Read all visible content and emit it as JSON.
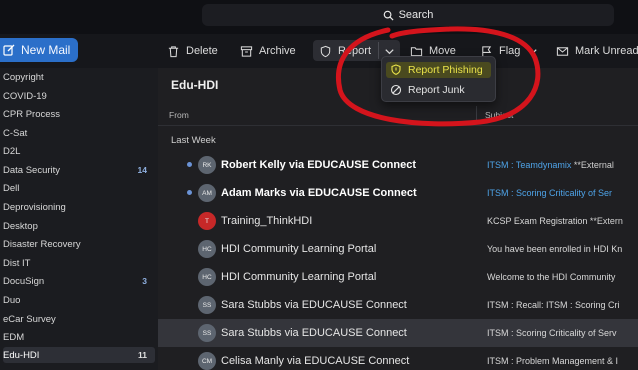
{
  "search": {
    "label": "Search"
  },
  "new_mail": {
    "label": "New Mail"
  },
  "toolbar": {
    "delete": "Delete",
    "archive": "Archive",
    "report": "Report",
    "move": "Move",
    "flag": "Flag",
    "mark_unread": "Mark Unread"
  },
  "report_menu": {
    "phishing": "Report Phishing",
    "junk": "Report Junk"
  },
  "sidebar": {
    "folders": [
      {
        "label": "Copyright",
        "count": ""
      },
      {
        "label": "COVID-19",
        "count": ""
      },
      {
        "label": "CPR Process",
        "count": ""
      },
      {
        "label": "C-Sat",
        "count": ""
      },
      {
        "label": "D2L",
        "count": ""
      },
      {
        "label": "Data Security",
        "count": "14"
      },
      {
        "label": "Dell",
        "count": ""
      },
      {
        "label": "Deprovisioning",
        "count": ""
      },
      {
        "label": "Desktop",
        "count": ""
      },
      {
        "label": "Disaster Recovery",
        "count": ""
      },
      {
        "label": "Dist IT",
        "count": ""
      },
      {
        "label": "DocuSign",
        "count": "3"
      },
      {
        "label": "Duo",
        "count": ""
      },
      {
        "label": "eCar Survey",
        "count": ""
      },
      {
        "label": "EDM",
        "count": ""
      },
      {
        "label": "Edu-HDI",
        "count": "11"
      }
    ]
  },
  "pane": {
    "title": "Edu-HDI",
    "col_from": "From",
    "col_subject": "Subject",
    "group": "Last Week"
  },
  "messages": [
    {
      "initials": "RK",
      "sender": "Robert Kelly via EDUCAUSE Connect",
      "subject": "ITSM : Teamdynamix",
      "tail": " **External",
      "unread": true
    },
    {
      "initials": "AM",
      "sender": "Adam Marks via EDUCAUSE Connect",
      "subject": "ITSM : Scoring Criticality of Ser",
      "tail": "",
      "unread": true
    },
    {
      "initials": "T",
      "sender": "Training_ThinkHDI",
      "subject": "KCSP Exam Registration",
      "tail": " **Extern",
      "unread": false
    },
    {
      "initials": "HC",
      "sender": "HDI Community Learning Portal",
      "subject": "You have been enrolled in HDI Kn",
      "tail": "",
      "unread": false
    },
    {
      "initials": "HC",
      "sender": "HDI Community Learning Portal",
      "subject": "Welcome to the HDI Community",
      "tail": "",
      "unread": false
    },
    {
      "initials": "SS",
      "sender": "Sara Stubbs via EDUCAUSE Connect",
      "subject": "ITSM : Recall: ITSM : Scoring Cri",
      "tail": "",
      "unread": false
    },
    {
      "initials": "SS",
      "sender": "Sara Stubbs via EDUCAUSE Connect",
      "subject": "ITSM : Scoring Criticality of Serv",
      "tail": "",
      "unread": false
    },
    {
      "initials": "CM",
      "sender": "Celisa Manly via EDUCAUSE Connect",
      "subject": "ITSM : Problem Management & I",
      "tail": "",
      "unread": false
    }
  ],
  "colors": {
    "accent": "#2b6fc9",
    "link": "#4ea3e8",
    "highlight_text": "#e9e24a",
    "annotation": "#d4141c"
  },
  "icons": [
    "search-icon",
    "compose-icon",
    "trash-icon",
    "archive-icon",
    "shield-icon",
    "chevron-down-icon",
    "folder-icon",
    "flag-icon",
    "envelope-icon",
    "block-icon"
  ]
}
